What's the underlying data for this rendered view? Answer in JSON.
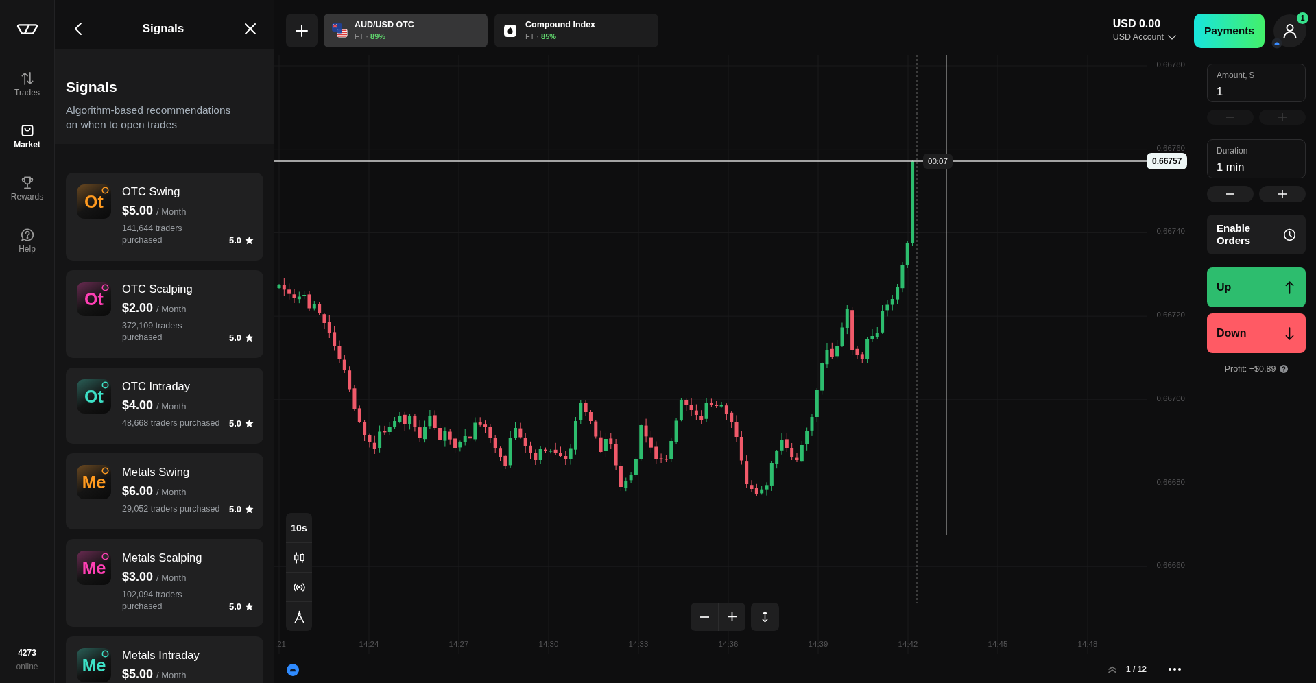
{
  "sidebar": {
    "items": [
      {
        "label": "Trades",
        "selected": false
      },
      {
        "label": "Market",
        "selected": true
      },
      {
        "label": "Rewards",
        "selected": false
      },
      {
        "label": "Help",
        "selected": false
      }
    ],
    "online_count": "4273",
    "online_label": "online"
  },
  "signals_panel": {
    "title": "Signals",
    "heading": "Signals",
    "description": "Algorithm-based recommendations on when to open trades",
    "cards": [
      {
        "logo_text": "Ot",
        "color": "#ff9a1f",
        "name": "OTC Swing",
        "price": "$5.00",
        "period": "/ Month",
        "traders": "141,644 traders purchased",
        "rating": "5.0"
      },
      {
        "logo_text": "Ot",
        "color": "#ff3fb4",
        "name": "OTC Scalping",
        "price": "$2.00",
        "period": "/ Month",
        "traders": "372,109 traders purchased",
        "rating": "5.0"
      },
      {
        "logo_text": "Ot",
        "color": "#3de0c6",
        "name": "OTC Intraday",
        "price": "$4.00",
        "period": "/ Month",
        "traders": "48,668 traders purchased",
        "rating": "5.0"
      },
      {
        "logo_text": "Me",
        "color": "#ff9a1f",
        "name": "Metals Swing",
        "price": "$6.00",
        "period": "/ Month",
        "traders": "29,052 traders purchased",
        "rating": "5.0"
      },
      {
        "logo_text": "Me",
        "color": "#ff3fb4",
        "name": "Metals Scalping",
        "price": "$3.00",
        "period": "/ Month",
        "traders": "102,094 traders purchased",
        "rating": "5.0"
      },
      {
        "logo_text": "Me",
        "color": "#3de0c6",
        "name": "Metals Intraday",
        "price": "$5.00",
        "period": "/ Month"
      }
    ]
  },
  "asset_tabs": [
    {
      "kind": "pair",
      "name": "AUD/USD OTC",
      "market": "FT ·",
      "payout": "89%",
      "selected": true
    },
    {
      "kind": "index",
      "name": "Compound Index",
      "market": "FT ·",
      "payout": "85%",
      "selected": false
    }
  ],
  "account": {
    "balance": "USD 0.00",
    "name": "USD Account"
  },
  "payments_button": "Payments",
  "profile": {
    "badge": "1"
  },
  "chart": {
    "y_labels": [
      "0.66780",
      "0.66760",
      "0.66740",
      "0.66720",
      "0.66700",
      "0.66680",
      "0.66660"
    ],
    "x_labels": [
      ":21",
      "14:24",
      "14:27",
      "14:30",
      "14:33",
      "14:36",
      "14:39",
      "14:42",
      "14:45",
      "14:48"
    ],
    "current_price": "0.66757",
    "timer": "00:07",
    "timeframe": "10s",
    "pagination": "1 / 12"
  },
  "trade_panel": {
    "amount": {
      "label": "Amount, $",
      "value": "1",
      "steppers_disabled": true
    },
    "duration": {
      "label": "Duration",
      "value": "1 min",
      "steppers_disabled": false
    },
    "orders_button": "Enable Orders",
    "up_button": "Up",
    "down_button": "Down",
    "profit": "Profit: +$0.89"
  }
}
